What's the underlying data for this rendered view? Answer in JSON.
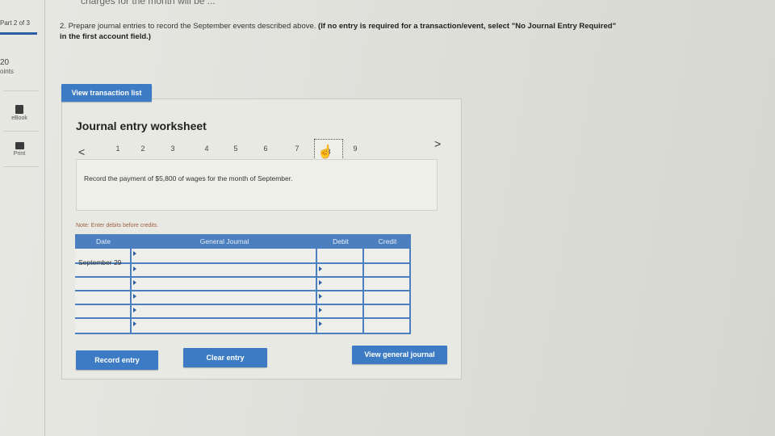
{
  "header": {
    "top_cut_text": "charges for the month will be ..."
  },
  "sidebar": {
    "part_label": "Part 2 of 3",
    "points_value": "20",
    "points_label": "oints",
    "ebook_label": "eBook",
    "print_label": "Print"
  },
  "question": {
    "number": "2.",
    "text": "Prepare journal entries to record the September events described above.",
    "instruction_bold": "(If no entry is required for a transaction/event, select \"No Journal Entry Required\" in the first account field.)"
  },
  "buttons": {
    "view_transaction_list": "View transaction list",
    "record_entry": "Record entry",
    "clear_entry": "Clear entry",
    "view_general_journal": "View general journal"
  },
  "worksheet": {
    "title": "Journal entry worksheet",
    "nav_prev": "<",
    "nav_next": ">",
    "pages": [
      "1",
      "2",
      "3",
      "4",
      "5",
      "6",
      "7",
      "8",
      "9"
    ],
    "current_page": "8",
    "description": "Record the payment of $5,800 of wages for the month of September.",
    "note": "Note: Enter debits before credits.",
    "table": {
      "headers": [
        "Date",
        "General Journal",
        "Debit",
        "Credit"
      ],
      "date_value": "September 29"
    }
  },
  "colors": {
    "accent": "#3d7cc4",
    "grid": "#4b7fbf"
  }
}
